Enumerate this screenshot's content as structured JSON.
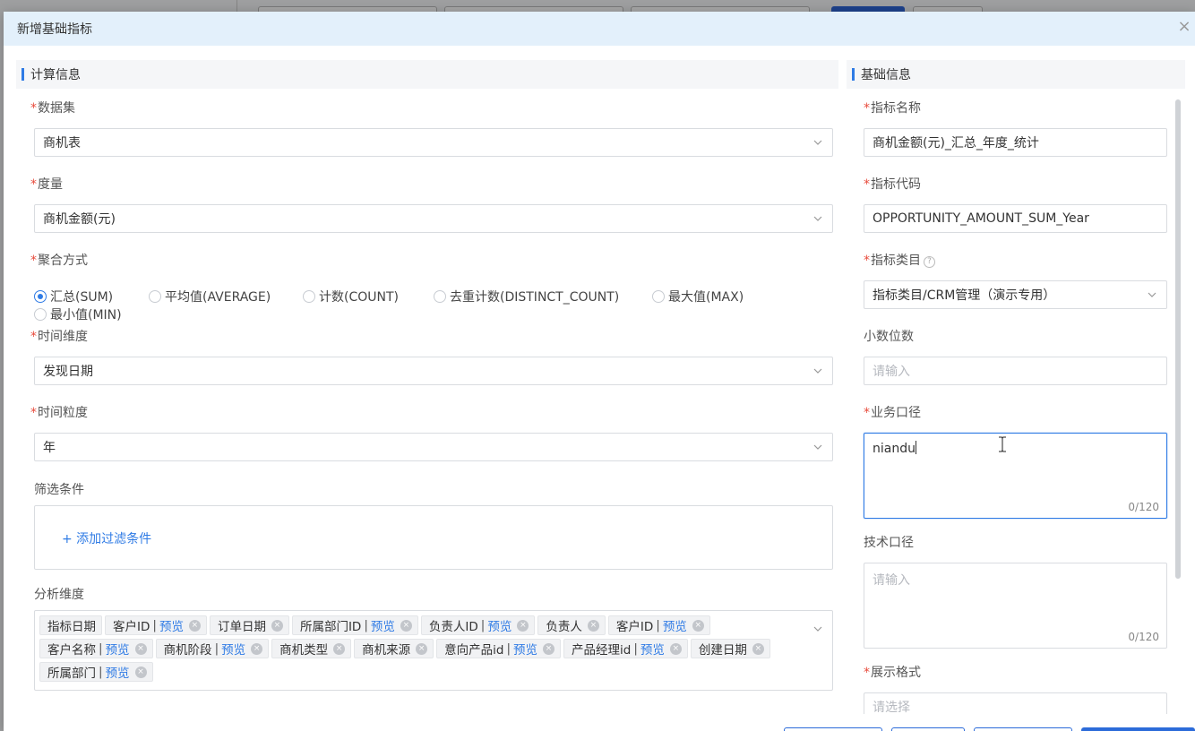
{
  "dialog": {
    "title": "新增基础指标",
    "close_label": "×"
  },
  "calc_section": {
    "title": "计算信息",
    "dataset": {
      "label": "数据集",
      "value": "商机表"
    },
    "measure": {
      "label": "度量",
      "value": "商机金额(元)"
    },
    "aggregation": {
      "label": "聚合方式",
      "options": [
        "汇总(SUM)",
        "平均值(AVERAGE)",
        "计数(COUNT)",
        "去重计数(DISTINCT_COUNT)",
        "最大值(MAX)",
        "最小值(MIN)"
      ],
      "selected": "汇总(SUM)"
    },
    "time_dimension": {
      "label": "时间维度",
      "value": "发现日期"
    },
    "time_granularity": {
      "label": "时间粒度",
      "value": "年"
    },
    "filter": {
      "label": "筛选条件",
      "add_label": "+ 添加过滤条件"
    },
    "analysis_dims": {
      "label": "分析维度",
      "preview_label": "预览",
      "tags": [
        {
          "text": "指标日期",
          "preview": false,
          "removable": false
        },
        {
          "text": "客户ID",
          "preview": true,
          "removable": true
        },
        {
          "text": "订单日期",
          "preview": false,
          "removable": true
        },
        {
          "text": "所属部门ID",
          "preview": true,
          "removable": true
        },
        {
          "text": "负责人ID",
          "preview": true,
          "removable": true
        },
        {
          "text": "负责人",
          "preview": false,
          "removable": true
        },
        {
          "text": "客户ID",
          "preview": true,
          "removable": true
        },
        {
          "text": "客户名称",
          "preview": true,
          "removable": true
        },
        {
          "text": "商机阶段",
          "preview": true,
          "removable": true
        },
        {
          "text": "商机类型",
          "preview": false,
          "removable": true
        },
        {
          "text": "商机来源",
          "preview": false,
          "removable": true
        },
        {
          "text": "意向产品id",
          "preview": true,
          "removable": true
        },
        {
          "text": "产品经理id",
          "preview": true,
          "removable": true
        },
        {
          "text": "创建日期",
          "preview": false,
          "removable": true
        },
        {
          "text": "所属部门",
          "preview": true,
          "removable": true
        }
      ]
    }
  },
  "basic_section": {
    "title": "基础信息",
    "metric_name": {
      "label": "指标名称",
      "value": "商机金额(元)_汇总_年度_统计"
    },
    "metric_code": {
      "label": "指标代码",
      "value": "OPPORTUNITY_AMOUNT_SUM_Year"
    },
    "metric_category": {
      "label": "指标类目",
      "help_icon": "?",
      "value": "指标类目/CRM管理（演示专用）"
    },
    "decimals": {
      "label": "小数位数",
      "placeholder": "请输入"
    },
    "business_caliber": {
      "label": "业务口径",
      "value": "niandu",
      "counter": "0/120"
    },
    "technical_caliber": {
      "label": "技术口径",
      "placeholder": "请输入",
      "counter": "0/120"
    },
    "display_format": {
      "label": "展示格式",
      "placeholder": "请选择"
    }
  },
  "required_mark": "*",
  "colors": {
    "accent": "#2f7be5",
    "header_bg": "#e3f0fb",
    "required": "#e84b3c"
  }
}
